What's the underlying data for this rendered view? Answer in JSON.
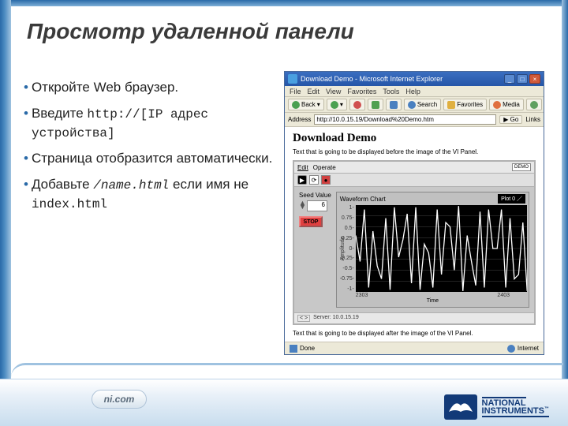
{
  "slide": {
    "title": "Просмотр удаленной панели",
    "bullets": [
      {
        "pre": "Откройте Web браузер.",
        "code": "",
        "post": ""
      },
      {
        "pre": "Введите ",
        "code": "http://[IP адрес устройства]",
        "post": ""
      },
      {
        "pre": "Страница отобразится автоматически.",
        "code": "",
        "post": ""
      },
      {
        "pre": "Добавьте ",
        "code": "/name.html",
        "post": " если имя не ",
        "code2": "index.html"
      }
    ]
  },
  "branding": {
    "nicom": "ni.com",
    "ni1": "NATIONAL",
    "ni2": "INSTRUMENTS",
    "tm": "™"
  },
  "ie": {
    "title": "Download Demo - Microsoft Internet Explorer",
    "menus": [
      "File",
      "Edit",
      "View",
      "Favorites",
      "Tools",
      "Help"
    ],
    "tb": {
      "back": "Back",
      "search": "Search",
      "fav": "Favorites",
      "media": "Media"
    },
    "addr_label": "Address",
    "url": "http://10.0.15.19/Download%20Demo.htm",
    "go": "Go",
    "links": "Links",
    "status_left": "Done",
    "status_right": "Internet"
  },
  "page": {
    "title": "Download Demo",
    "before": "Text that is going to be displayed before the image of the VI Panel.",
    "after": "Text that is going to be displayed after the image of the VI Panel."
  },
  "vi": {
    "menus": [
      "Edit",
      "Operate"
    ],
    "demo": "DEMO",
    "seed_label": "Seed Value",
    "seed_value": "6",
    "stop": "STOP",
    "status_server": "Server: 10.0.15.19",
    "status_sym": "< >",
    "chart_title": "Waveform Chart",
    "plot_label": "Plot 0",
    "yticks": [
      "1-",
      "0.75-",
      "0.5-",
      "0.25-",
      "0-",
      "-0.25-",
      "-0.5-",
      "-0.75-",
      "-1-"
    ],
    "x_left": "2303",
    "x_right": "2403",
    "xlabel": "Time",
    "ylabel": "Amplitude"
  },
  "chart_data": {
    "type": "line",
    "title": "Waveform Chart",
    "xlabel": "Time",
    "ylabel": "Amplitude",
    "xlim": [
      2303,
      2403
    ],
    "ylim": [
      -1,
      1
    ],
    "series": [
      {
        "name": "Plot 0",
        "x": [
          2303,
          2308,
          2313,
          2318,
          2323,
          2328,
          2333,
          2338,
          2343,
          2348,
          2353,
          2358,
          2363,
          2368,
          2373,
          2378,
          2383,
          2388,
          2393,
          2398,
          2403
        ],
        "y": [
          0.3,
          0.9,
          0.4,
          -0.7,
          -0.95,
          -0.2,
          0.8,
          0.95,
          0.1,
          -0.9,
          -0.6,
          0.5,
          0.98,
          0.3,
          -0.85,
          -0.9,
          0.0,
          0.9,
          0.7,
          -0.6,
          -0.98
        ]
      }
    ]
  }
}
